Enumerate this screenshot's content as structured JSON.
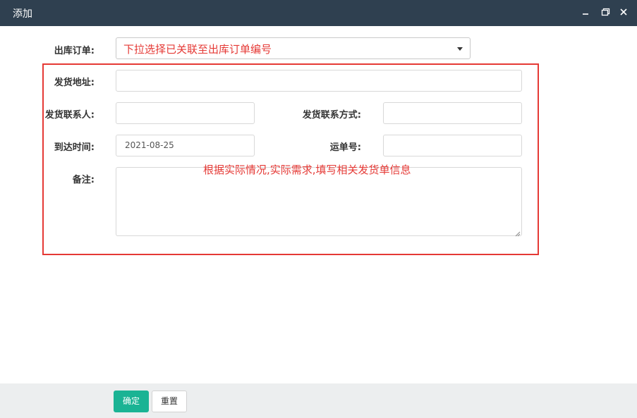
{
  "dialog": {
    "title": "添加"
  },
  "form": {
    "order_label": "出库订单:",
    "order_placeholder": "下拉选择已关联至出库订单编号",
    "address_label": "发货地址:",
    "address_value": "",
    "contact_label": "发货联系人:",
    "contact_value": "",
    "contact_method_label": "发货联系方式:",
    "contact_method_value": "",
    "arrival_label": "到达时间:",
    "arrival_value": "2021-08-25",
    "waybill_label": "运单号:",
    "waybill_value": "",
    "remark_label": "备注:",
    "remark_value": ""
  },
  "annotation": {
    "text": "根据实际情况,实际需求,填写相关发货单信息",
    "color": "#e53935"
  },
  "footer": {
    "confirm_label": "确定",
    "reset_label": "重置"
  },
  "colors": {
    "titlebar": "#2f4050",
    "accent": "#1ab394",
    "annotation_red": "#e53935"
  }
}
